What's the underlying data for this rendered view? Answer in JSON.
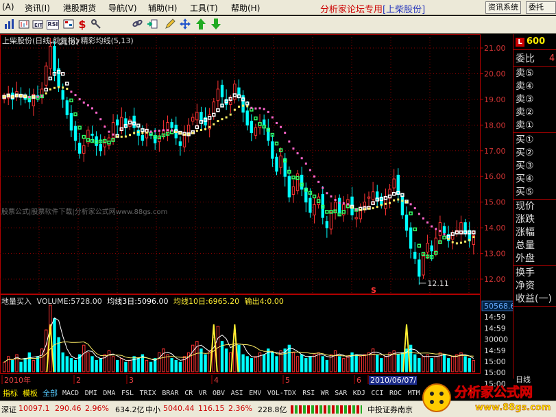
{
  "menu": {
    "items": [
      "(A)",
      "资讯(I)",
      "港股期货",
      "导航(V)",
      "辅助(H)",
      "工具(T)",
      "帮助(H)"
    ],
    "title_prefix": "分析家论坛专用",
    "title_stock": "[上柴股份]",
    "btn_info": "资讯系统",
    "btn_close": "委托"
  },
  "toolbar": {
    "icons": [
      "bar-chart-icon",
      "kline-icon",
      "rsi-icon",
      "stock-icon",
      "dollar-icon",
      "tool-icon",
      "chain-icon",
      "export-icon",
      "pencil-icon",
      "move-icon",
      "arrow-up-icon",
      "arrow-down-icon"
    ],
    "labels": [
      "",
      "",
      "RSI",
      "",
      "$",
      "",
      "",
      "",
      "",
      "",
      "",
      ""
    ]
  },
  "chart": {
    "info_line": "上柴股份(日线,前复权)  精彩均线(5,13)",
    "watermark": "股票公式|股票软件下载|分析家公式网www.88gs.com",
    "high_label": "21.07",
    "low_label": "12.11",
    "s_marker": "S"
  },
  "volume": {
    "title": "地量买入",
    "vol": "VOLUME:5728.00",
    "ma3": "均线3日:5096.00",
    "ma10": "均线10日:6965.20",
    "out": "输出4:0.00"
  },
  "chart_data": {
    "type": "candlestick",
    "price_axis_ticks": [
      "21.00",
      "20.00",
      "19.00",
      "18.00",
      "17.00",
      "16.00",
      "15.00",
      "14.00",
      "13.00",
      "12.00"
    ],
    "price_ylim": [
      12.0,
      21.0
    ],
    "volume_axis_ticks": [
      "50568.6",
      "14:59",
      "14:59",
      "30000",
      "14:59",
      "15:00",
      "15:00",
      "15:00"
    ],
    "x_labels": [
      "2010年",
      "2",
      "3",
      "4",
      "5",
      "6",
      "2010/06/07/"
    ],
    "price_path": [
      19.1,
      19.2,
      19.0,
      19.3,
      19.1,
      19.0,
      18.9,
      19.2,
      19.1,
      19.4,
      20.3,
      21.07,
      20.1,
      19.5,
      19.0,
      18.4,
      17.8,
      17.4,
      16.9,
      17.2,
      17.8,
      17.6,
      17.2,
      17.0,
      17.3,
      17.5,
      18.1,
      18.0,
      18.3,
      17.9,
      18.2,
      17.9,
      17.6,
      17.4,
      17.8,
      17.6,
      17.3,
      17.5,
      17.8,
      18.1,
      17.9,
      17.5,
      17.2,
      17.6,
      18.0,
      18.3,
      18.5,
      18.2,
      18.0,
      18.4,
      18.9,
      19.4,
      19.1,
      18.8,
      18.9,
      19.6,
      19.2,
      18.5,
      18.0,
      17.7,
      17.9,
      18.1,
      18.0,
      17.4,
      16.7,
      16.2,
      16.8,
      16.0,
      15.2,
      15.6,
      16.1,
      15.5,
      15.0,
      14.6,
      14.9,
      15.2,
      14.4,
      14.0,
      14.6,
      15.0,
      14.6,
      14.9,
      15.1,
      14.5,
      14.4,
      14.8,
      15.0,
      15.2,
      15.4,
      15.1,
      14.9,
      15.2,
      15.5,
      15.9,
      15.3,
      14.5,
      13.9,
      13.2,
      12.8,
      12.11,
      12.9,
      13.4,
      13.1,
      13.6,
      14.2,
      13.8,
      13.5,
      13.7,
      13.9,
      14.2,
      13.8,
      13.5,
      13.7
    ],
    "volume_path": [
      5,
      8,
      6,
      9,
      5,
      7,
      10,
      6,
      8,
      12,
      22,
      35,
      28,
      18,
      10,
      8,
      7,
      6,
      9,
      14,
      10,
      8,
      6,
      7,
      9,
      11,
      8,
      6,
      7,
      5,
      6,
      8,
      7,
      9,
      6,
      5,
      7,
      10,
      12,
      9,
      7,
      6,
      5,
      8,
      10,
      14,
      16,
      12,
      9,
      11,
      18,
      24,
      16,
      12,
      10,
      20,
      14,
      9,
      8,
      7,
      8,
      10,
      9,
      12,
      10,
      8,
      11,
      12,
      14,
      10,
      8,
      9,
      7,
      8,
      9,
      10,
      8,
      6,
      9,
      11,
      8,
      7,
      8,
      10,
      9,
      8,
      9,
      10,
      12,
      9,
      7,
      8,
      10,
      11,
      9,
      10,
      12,
      14,
      9,
      7,
      8,
      9,
      7,
      8,
      10,
      9,
      7,
      8,
      9,
      10,
      8,
      7,
      6
    ],
    "volume_ylim": [
      0,
      50568.6
    ],
    "series": [
      {
        "name": "",
        "color": "#ffffff"
      },
      {
        "name": "",
        "color": "#ffee66"
      }
    ]
  },
  "right_panel": {
    "code_box": "L",
    "code": "600",
    "weibi": "委比",
    "weibi_val": "4",
    "sell": [
      "卖⑤",
      "卖④",
      "卖③",
      "卖②",
      "卖①"
    ],
    "buy": [
      "买①",
      "买②",
      "买③",
      "买④",
      "买⑤"
    ],
    "quote": [
      "现价",
      "涨跌",
      "涨幅",
      "总量",
      "外盘"
    ],
    "extra": [
      "换手",
      "净资",
      "收益(一)"
    ],
    "bottom_label": "日线"
  },
  "tabs": [
    "指标",
    "模板",
    "全部",
    "MACD",
    "DMI",
    "DMA",
    "FSL",
    "TRIX",
    "BRAR",
    "CR",
    "VR",
    "OBV",
    "ASI",
    "EMV",
    "VOL-TDX",
    "RSI",
    "WR",
    "SAR",
    "KDJ",
    "CCI",
    "ROC",
    "MTM"
  ],
  "status": {
    "sz_label": "深证",
    "sz_index": "10097.1",
    "sz_change": "290.46",
    "sz_pct": "2.96%",
    "sz_amount": "634.2亿",
    "zx_label": "中小",
    "zx_index": "5040.44",
    "zx_change": "116.15",
    "zx_pct": "2.36%",
    "zx_amount": "228.8亿",
    "broker": "中投证券南京"
  },
  "logo": {
    "text": "分析家公式网",
    "url": "www.88gs.com"
  },
  "colors": {
    "up": "#ff3333",
    "down": "#00ffff",
    "ma_short": "#ffffff",
    "ma_long": "#ffee66",
    "highlight": "#ffee00",
    "grid": "#880000"
  }
}
